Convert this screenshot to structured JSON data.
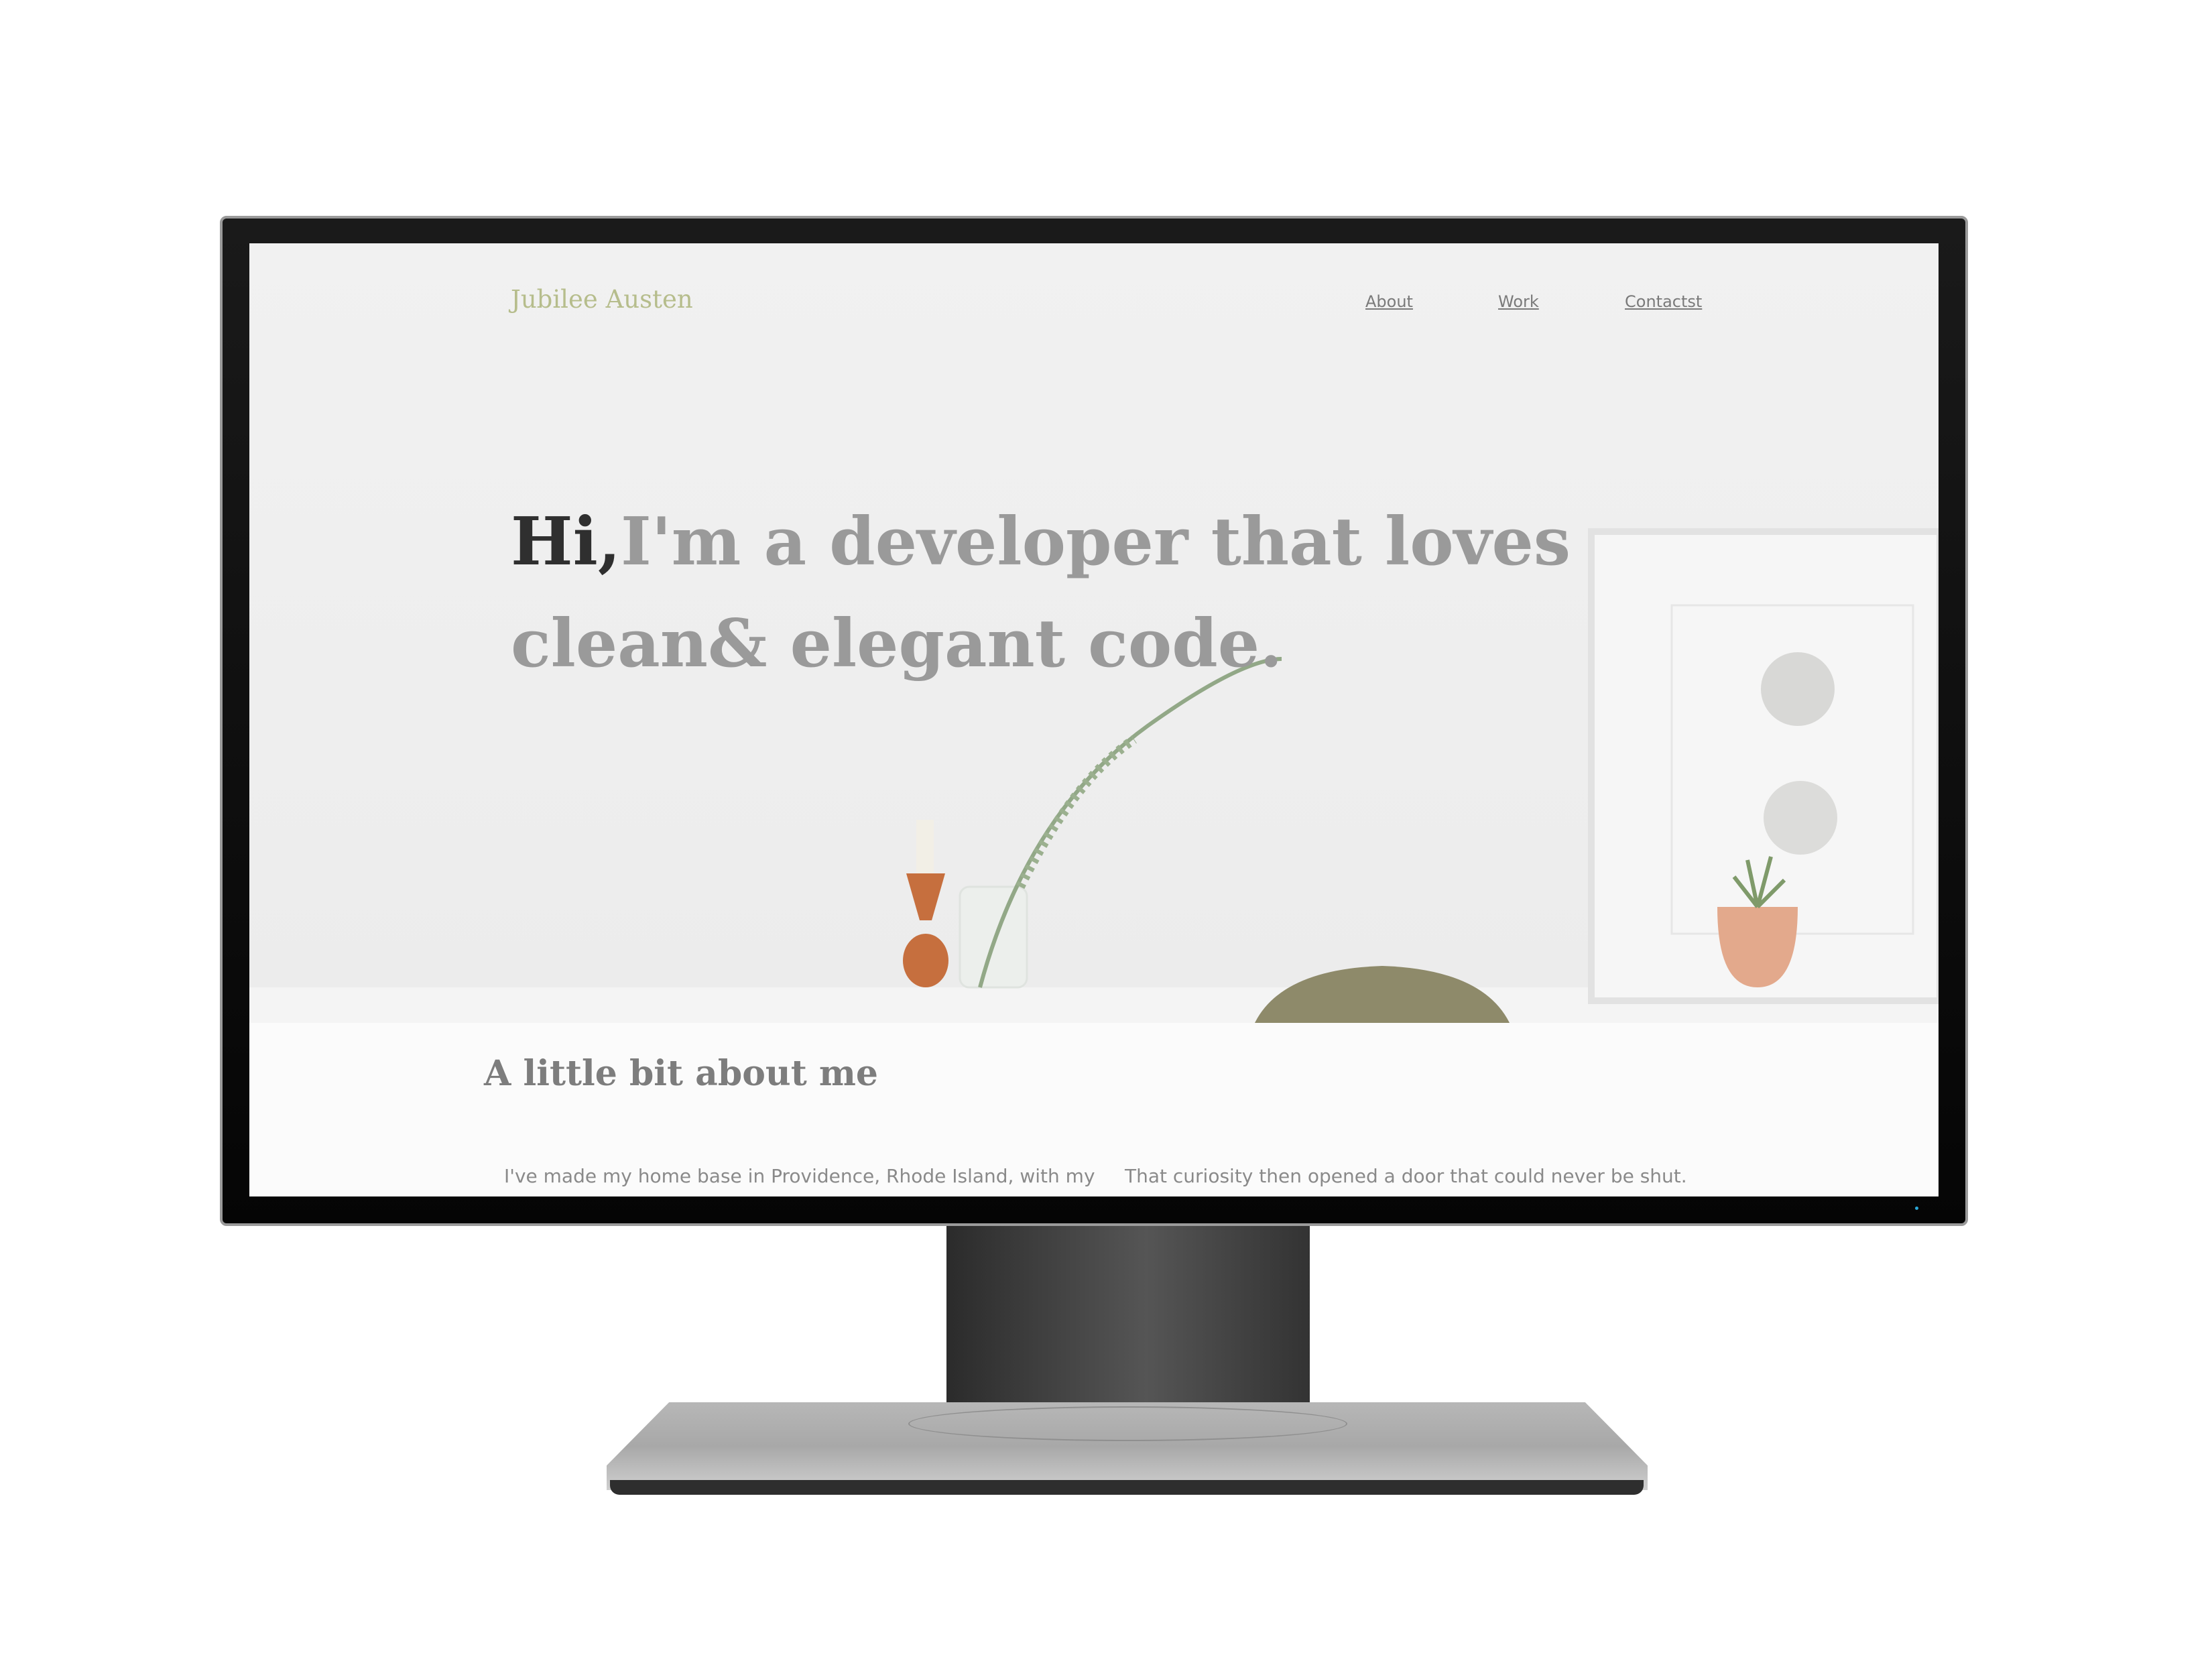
{
  "site": {
    "logo": "Jubilee Austen",
    "nav": [
      {
        "label": "About"
      },
      {
        "label": "Work"
      },
      {
        "label": "Contactst"
      }
    ]
  },
  "hero": {
    "greeting": "Hi,",
    "line1_rest": "I'm a developer that loves",
    "line2": "clean& elegant code."
  },
  "about": {
    "heading": "A little bit about me",
    "col_left": "I've made my home base in Providence, Rhode Island, with my",
    "col_right": "That curiosity then opened a door that could never be shut."
  },
  "colors": {
    "logo": "#b6bd8c",
    "headline_accent": "#2f2f2f",
    "headline": "#9a9a9a"
  }
}
